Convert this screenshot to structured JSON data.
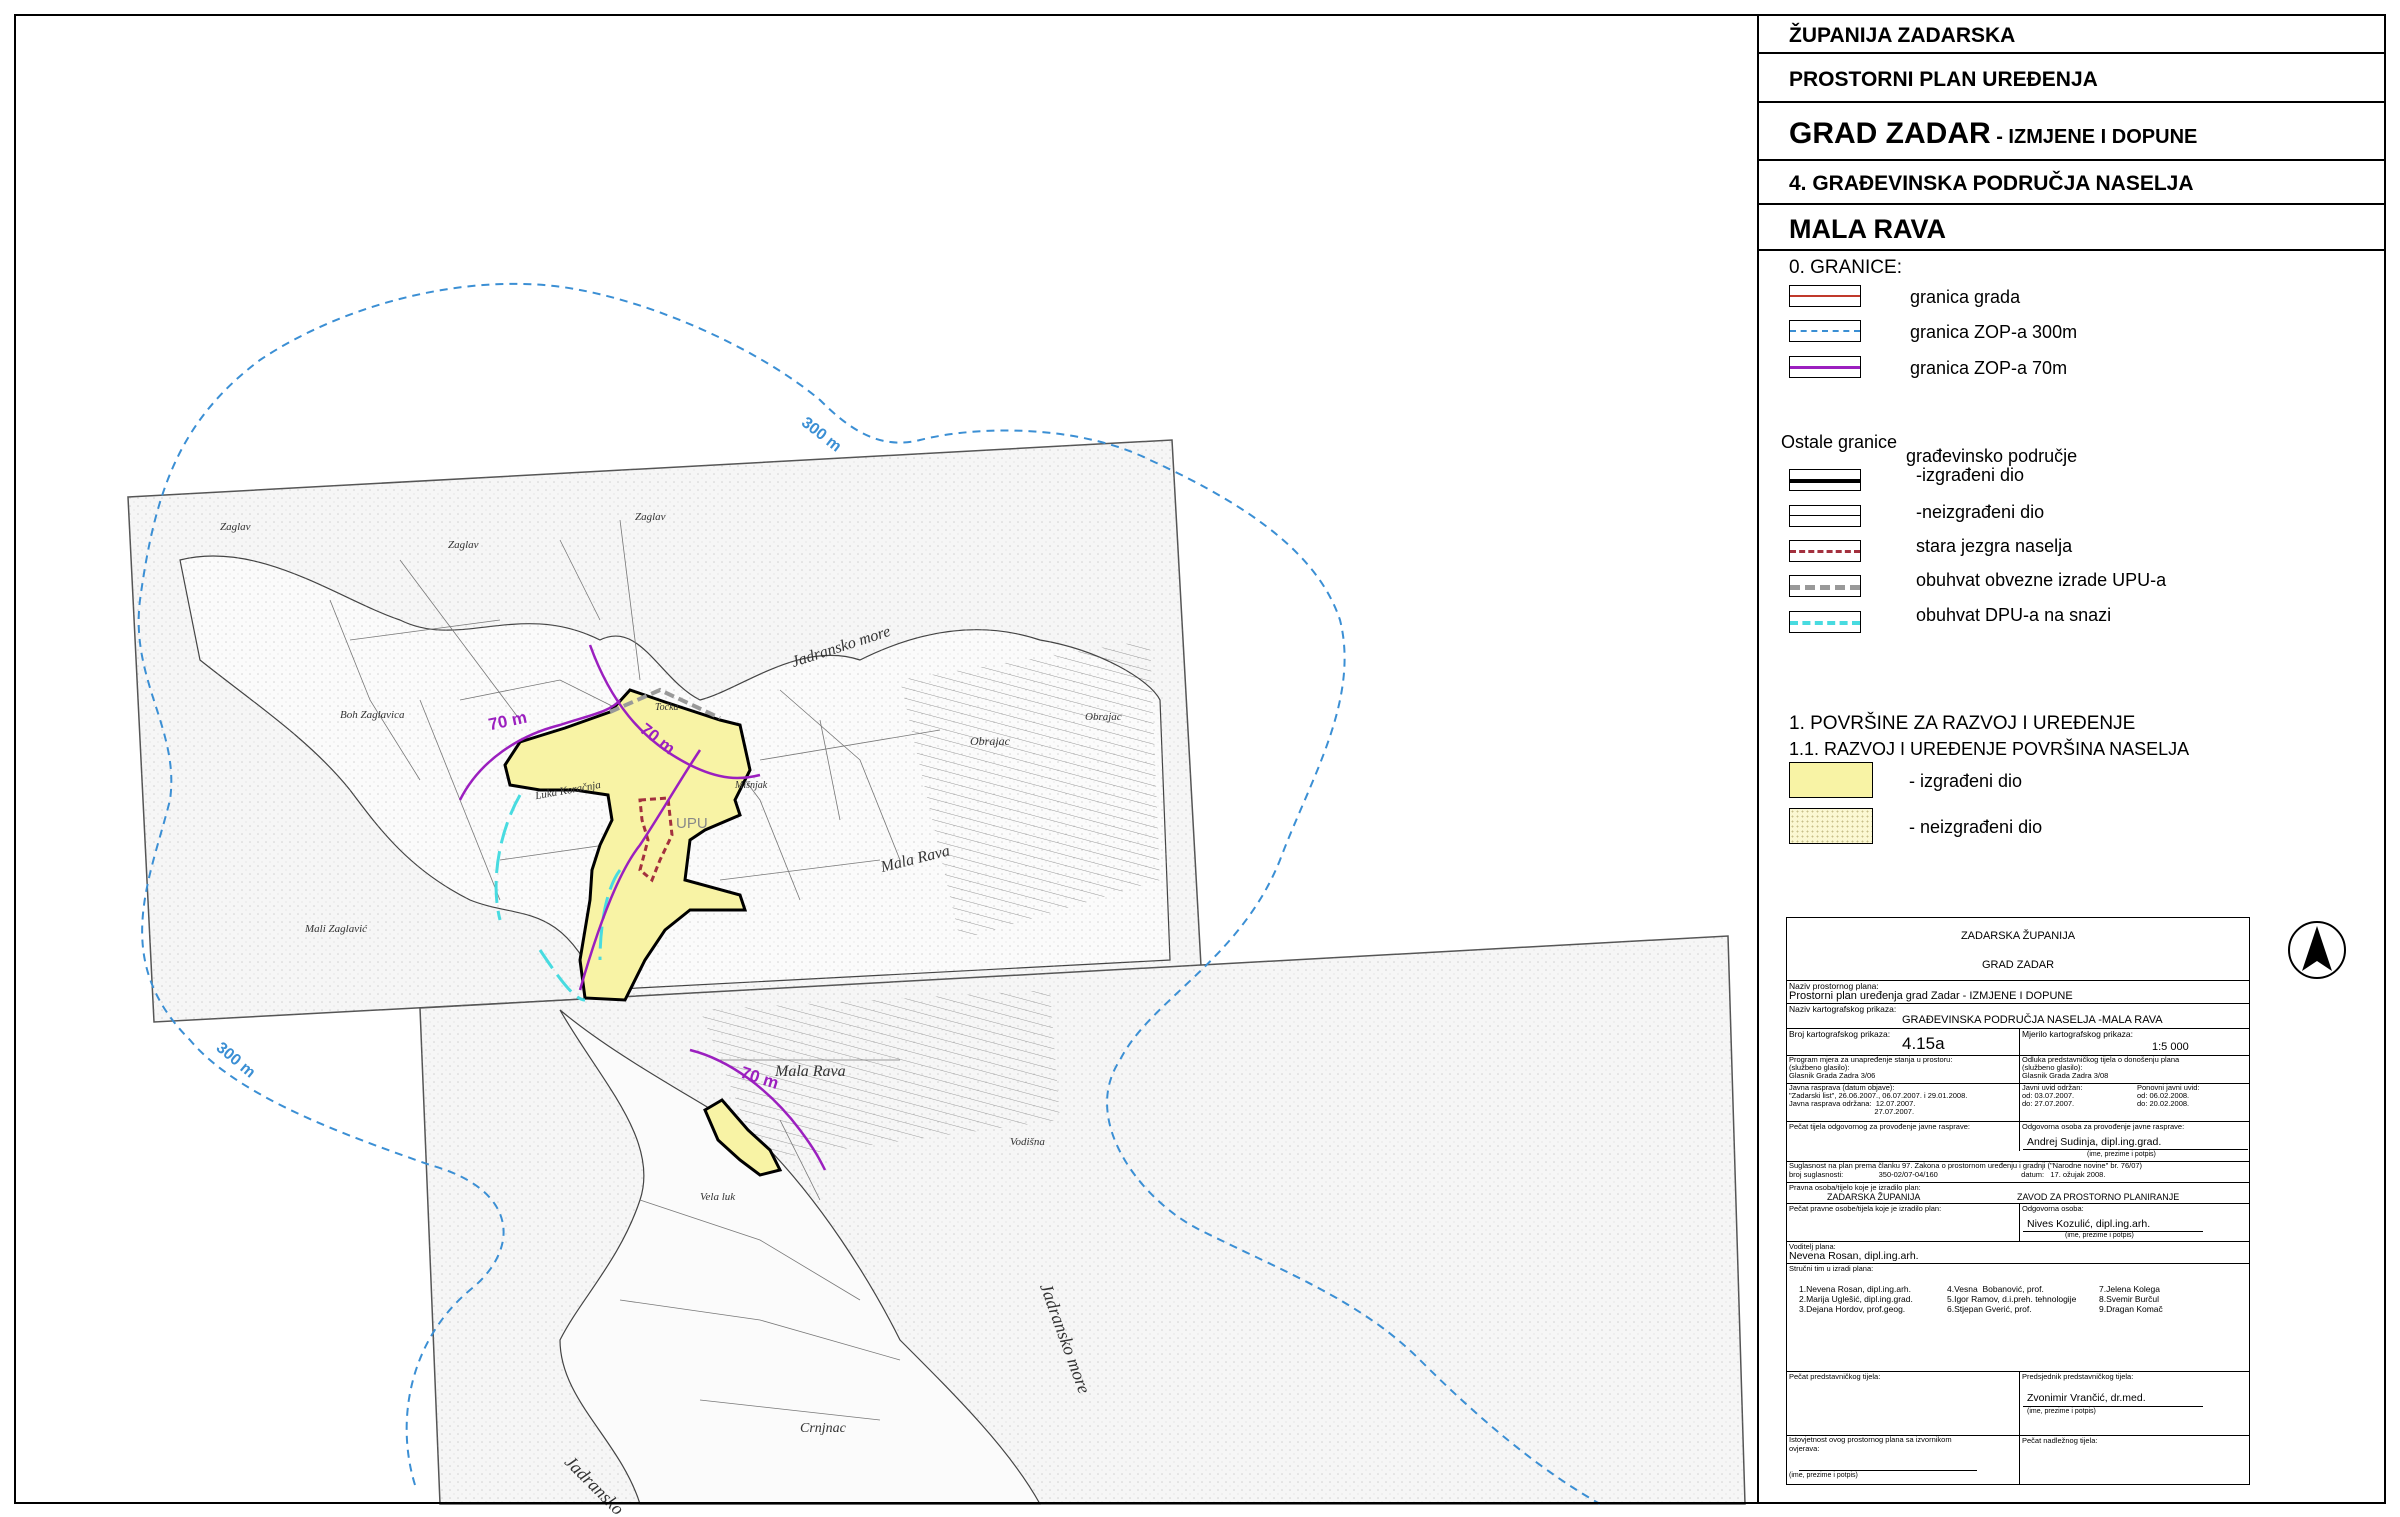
{
  "header": {
    "county": "ŽUPANIJA ZADARSKA",
    "plan": "PROSTORNI PLAN UREĐENJA",
    "city": "GRAD ZADAR",
    "city_suffix": " - IZMJENE I DOPUNE",
    "map_title": "4. GRAĐEVINSKA PODRUČJA NASELJA",
    "place": "MALA RAVA"
  },
  "legend": {
    "granice": {
      "title": "0. GRANICE:",
      "items": [
        {
          "label": "granica grada",
          "color": "#c0392b"
        },
        {
          "label": "granica ZOP-a 300m",
          "color": "#3b8fd4"
        },
        {
          "label": "granica ZOP-a 70m",
          "color": "#9b1fbf"
        }
      ]
    },
    "ostale": {
      "title": "Ostale granice",
      "subtitle": "građevinsko područje",
      "items": [
        {
          "label": "-izgrađeni dio"
        },
        {
          "label": "-neizgrađeni dio"
        },
        {
          "label": "stara jezgra naselja",
          "color": "#a3303e"
        },
        {
          "label": "obuhvat obvezne izrade UPU-a",
          "color": "#999999"
        },
        {
          "label": "obuhvat  DPU-a na snazi",
          "color": "#48dbe0"
        }
      ]
    },
    "povrsine": {
      "title": "1. POVRŠINE ZA RAZVOJ I UREĐENJE",
      "subtitle": "1.1. RAZVOJ I UREĐENJE POVRŠINA NASELJA",
      "items": [
        {
          "label": "- izgrađeni dio",
          "color": "#f8f3a5"
        },
        {
          "label": "- neizgrađeni dio",
          "color": "#fbf8d2"
        }
      ]
    }
  },
  "map": {
    "zop300_labels": [
      "300 m",
      "300 m"
    ],
    "zop70_labels": [
      "70 m",
      "70 m",
      "70 m"
    ],
    "upu_label": "UPU",
    "place_names": [
      "Zaglav",
      "Zaglav",
      "Zaglav",
      "Boh Zaglavica",
      "Jadransko more",
      "Luka Koračnja",
      "Mala Rava",
      "Obrajac",
      "Obrajac",
      "Mali Zaglavić",
      "Mala Rava",
      "Vodišna",
      "Vela luk",
      "Jadransko more",
      "Crnjnac",
      "Jadransko",
      "Mišnjak",
      "Točka"
    ],
    "north_symbol": "N",
    "colors": {
      "zop300": "#3b8fd4",
      "zop70": "#9b1fbf",
      "built": "#f8f3a5",
      "dpu": "#48dbe0",
      "core": "#a3303e"
    }
  },
  "titleblock": {
    "org1": "ZADARSKA ŽUPANIJA",
    "org2": "GRAD ZADAR",
    "naziv_label": "Naziv prostornog plana:",
    "naziv_value": "Prostorni plan uređenja grad Zadar - IZMJENE I DOPUNE",
    "kart_label": "Naziv kartografskog prikaza:",
    "kart_value": "GRAĐEVINSKA  PODRUČJA NASELJA -MALA RAVA",
    "broj_label": "Broj kartografskog prikaza:",
    "broj_value": "4.15a",
    "mjerilo_label": "Mjerilo kartografskog prikaza:",
    "mjerilo_value": "1:5 000",
    "program_text": "Program mjera za unapređenje stanja u prostoru:\n(službeno glasilo):\nGlasnik Grada Zadra 3/06",
    "odluka_text": "Odluka predstavničkog tijela o donošenju plana\n(službeno glasilo):\nGlasnik Grada Zadra 3/08",
    "rasprava_text": "Javna rasprava (datum objave):\n\"Zadarski list\", 26.06.2007., 06.07.2007. i 29.01.2008.\nJavna rasprava održana:  12.07.2007.\n                                         27.07.2007.",
    "uvid_a": "Javni uvid održan:\nod: 03.07.2007.\ndo: 27.07.2007.",
    "uvid_b": "Ponovni javni uvid:\nod: 06.02.2008.\ndo: 20.02.2008.",
    "pecat_rasprave": "Pečat tijela odgovornog za provođenje javne rasprave:",
    "odgovorna_label": "Odgovorna osoba za provođenje javne rasprave:",
    "odgovorna_name": "Andrej Sudinja, dipl.ing.grad.",
    "ime_prezime": "(ime, prezime i potpis)",
    "suglasnost": "Suglasnost na plan prema članku 97. Zakona o prostornom uređenju i gradnji (\"Narodne novine\" br. 76/07)\nbroj suglasnosti:                 350-02/07-04/160                                        datum:   17. ožujak 2008.",
    "pravna_label": "Pravna osoba/tijelo koje je izradilo plan:",
    "pravna_a": "ZADARSKA  ŽUPANIJA",
    "pravna_b": "ZAVOD ZA PROSTORNO PLANIRANJE",
    "pecat_izradio": "Pečat pravne osobe/tijela koje je izradilo plan:",
    "odgovorna_osoba_label": "Odgovorna osoba:",
    "odgovorna_osoba": "Nives Kozulić, dipl.ing.arh.",
    "voditelj_label": "Voditelj plana:",
    "voditelj": "Nevena Rosan, dipl.ing.arh.",
    "tim_label": "Stručni tim u izradi plana:",
    "tim_col1": "1.Nevena Rosan, dipl.ing.arh.\n2.Marija Uglešić, dipl.ing.grad.\n3.Dejana Hordov, prof.geog.",
    "tim_col2": "4.Vesna  Bobanović, prof.\n5.Igor Ramov, d.i.preh. tehnologije\n6.Stjepan Gverić, prof.",
    "tim_col3": "7.Jelena Kolega\n8.Svemir Burčul\n9.Dragan Komač",
    "pecat_pred_label": "Pečat predstavničkog tijela:",
    "predsjednik_label": "Predsjednik predstavničkog tijela:",
    "predsjednik": "Zvonimir Vrančić, dr.med.",
    "istovjetnost": "Istovjetnost ovog prostornog plana sa izvornikom\novjerava:",
    "pecat_nadlezno": "Pečat nadležnog tijela:"
  }
}
